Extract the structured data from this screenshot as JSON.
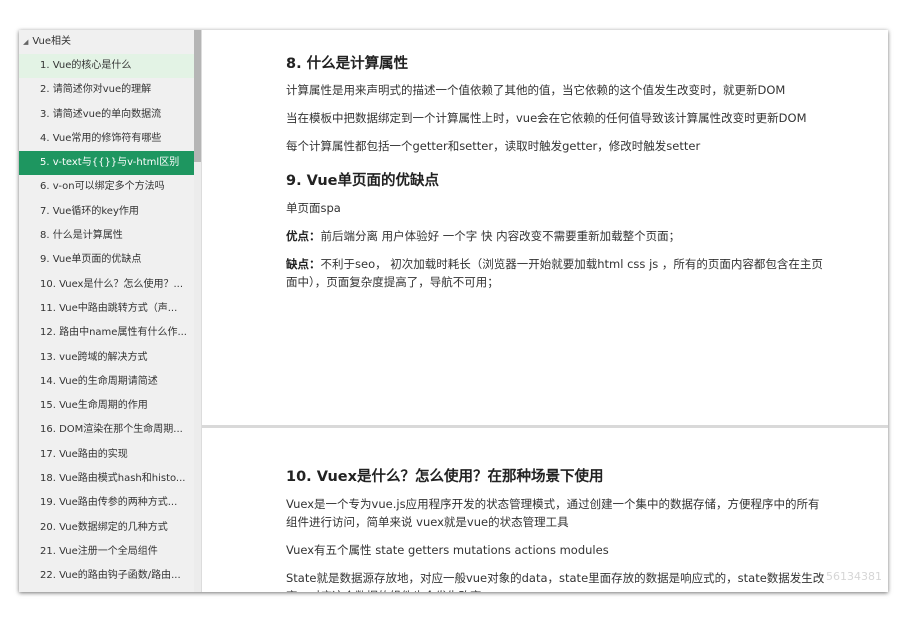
{
  "sidebar": {
    "header": "Vue相关",
    "items": [
      "1. Vue的核心是什么",
      "2. 请简述你对vue的理解",
      "3. 请简述vue的单向数据流",
      "4. Vue常用的修饰符有哪些",
      "5. v-text与{{}}与v-html区别",
      "6. v-on可以绑定多个方法吗",
      "7. Vue循环的key作用",
      "8. 什么是计算属性",
      "9. Vue单页面的优缺点",
      "10. Vuex是什么？怎么使用？...",
      "11. Vue中路由跳转方式（声...",
      "12. 路由中name属性有什么作...",
      "13. vue跨域的解决方式",
      "14. Vue的生命周期请简述",
      "15. Vue生命周期的作用",
      "16. DOM渲染在那个生命周期...",
      "17. Vue路由的实现",
      "18. Vue路由模式hash和histo...",
      "19. Vue路由传参的两种方式...",
      "20. Vue数据绑定的几种方式",
      "21. Vue注册一个全局组件",
      "22. Vue的路由钩子函数/路由..."
    ],
    "hover_index": 0,
    "active_index": 4
  },
  "content": {
    "s8": {
      "title": "8. 什么是计算属性",
      "p1": "计算属性是用来声明式的描述一个值依赖了其他的值，当它依赖的这个值发生改变时，就更新DOM",
      "p2": "当在模板中把数据绑定到一个计算属性上时，vue会在它依赖的任何值导致该计算属性改变时更新DOM",
      "p3": "每个计算属性都包括一个getter和setter，读取时触发getter，修改时触发setter"
    },
    "s9": {
      "title": "9. Vue单页面的优缺点",
      "p1": "单页面spa",
      "pros_label": "优点：",
      "pros": "前后端分离 用户体验好 一个字 快 内容改变不需要重新加载整个页面；",
      "cons_label": "缺点：",
      "cons": "不利于seo， 初次加载时耗长（浏览器一开始就要加载html css js ，所有的页面内容都包含在主页面中），页面复杂度提高了，导航不可用；"
    },
    "s10": {
      "title": "10. Vuex是什么？怎么使用？在那种场景下使用",
      "p1": "Vuex是一个专为vue.js应用程序开发的状态管理模式，通过创建一个集中的数据存储，方便程序中的所有组件进行访问，简单来说 vuex就是vue的状态管理工具",
      "p2": "Vuex有五个属性 state  getters  mutations  actions  modules",
      "p3": "State就是数据源存放地，对应一般vue对象的data，state里面存放的数据是响应式的，state数据发生改变，对应这个数据的组件也会发生改变"
    },
    "watermark": "56134381"
  },
  "colors": {
    "active": "#1e9660",
    "hover": "#e3f3e5",
    "sidebar_bg": "#f0f0f0"
  }
}
